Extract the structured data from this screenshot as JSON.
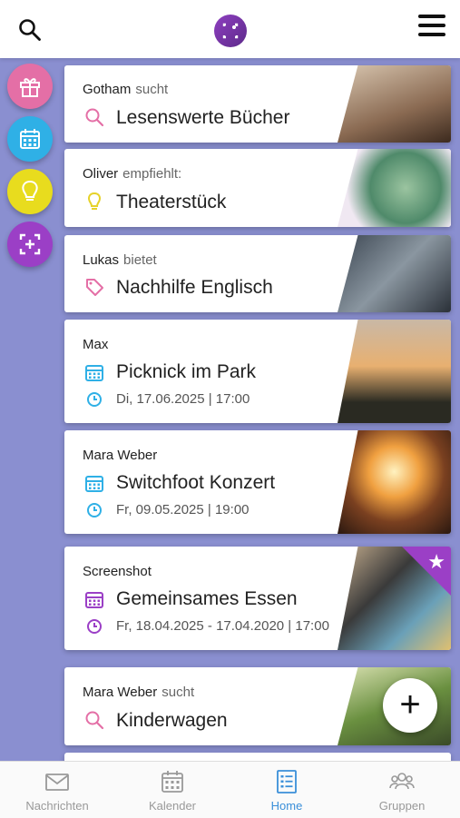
{
  "sidebar": {
    "gift_color": "#e46fa6",
    "calendar_color": "#2fb0e6",
    "idea_color": "#e8dc1e",
    "add_color": "#9b3fc6"
  },
  "cards": [
    {
      "who": "Gotham",
      "verb": "sucht",
      "title": "Lesenswerte Bücher",
      "icon": "search-icon",
      "icon_color": "#e46fa6"
    },
    {
      "who": "Oliver",
      "verb": "empfiehlt:",
      "title": "Theaterstück",
      "icon": "lightbulb-icon",
      "icon_color": "#e6d22a"
    },
    {
      "who": "Lukas",
      "verb": "bietet",
      "title": "Nachhilfe Englisch",
      "icon": "tag-icon",
      "icon_color": "#e46fa6"
    },
    {
      "who": "Max",
      "verb": "",
      "title": "Picknick im Park",
      "date": "Di, 17.06.2025 | 17:00",
      "icon": "calendar-icon",
      "icon_color": "#2fb0e6"
    },
    {
      "who": "Mara Weber",
      "verb": "",
      "title": "Switchfoot Konzert",
      "date": "Fr, 09.05.2025 | 19:00",
      "icon": "calendar-icon",
      "icon_color": "#2fb0e6"
    },
    {
      "who": "Screenshot",
      "verb": "",
      "title": "Gemeinsames Essen",
      "date": "Fr, 18.04.2025 - 17.04.2020 | 17:00",
      "icon": "calendar-icon",
      "icon_color": "#9b3fc6"
    },
    {
      "who": "Mara Weber",
      "verb": "sucht",
      "title": "Kinderwagen",
      "icon": "search-icon",
      "icon_color": "#e46fa6"
    }
  ],
  "fab": {
    "label": "+"
  },
  "bottom_nav": [
    {
      "label": "Nachrichten"
    },
    {
      "label": "Kalender"
    },
    {
      "label": "Home"
    },
    {
      "label": "Gruppen"
    }
  ],
  "colors": {
    "active_tab": "#3a8fd9",
    "background": "#8a8fd0",
    "favorite": "#9b3fc6"
  }
}
